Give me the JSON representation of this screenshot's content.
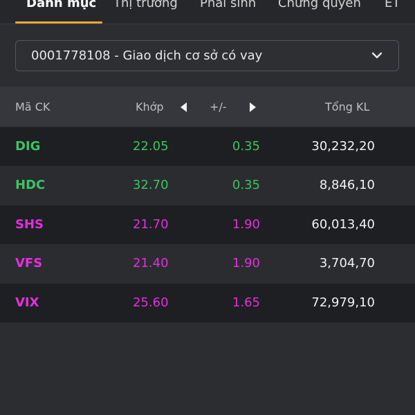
{
  "colors": {
    "up": "#3cc463",
    "ceiling": "#e22fe0",
    "accent": "#f0a43a"
  },
  "tabs": [
    {
      "label": "Danh mục",
      "active": true
    },
    {
      "label": "Thị trường"
    },
    {
      "label": "Phái sinh"
    },
    {
      "label": "Chứng quyền"
    },
    {
      "label": "ET"
    }
  ],
  "account": {
    "selected": "0001778108 - Giao dịch cơ sở có vay",
    "icon": "chevron-down-icon"
  },
  "table": {
    "headers": {
      "symbol": "Mã CK",
      "match": "Khớp",
      "change": "+/-",
      "volume": "Tổng KL"
    },
    "rows": [
      {
        "symbol": "DIG",
        "price": "22.05",
        "change": "0.35",
        "volume": "30,232,20",
        "status": "up"
      },
      {
        "symbol": "HDC",
        "price": "32.70",
        "change": "0.35",
        "volume": "8,846,10",
        "status": "up"
      },
      {
        "symbol": "SHS",
        "price": "21.70",
        "change": "1.90",
        "volume": "60,013,40",
        "status": "ceiling"
      },
      {
        "symbol": "VFS",
        "price": "21.40",
        "change": "1.90",
        "volume": "3,704,70",
        "status": "ceiling"
      },
      {
        "symbol": "VIX",
        "price": "25.60",
        "change": "1.65",
        "volume": "72,979,10",
        "status": "ceiling"
      }
    ]
  }
}
